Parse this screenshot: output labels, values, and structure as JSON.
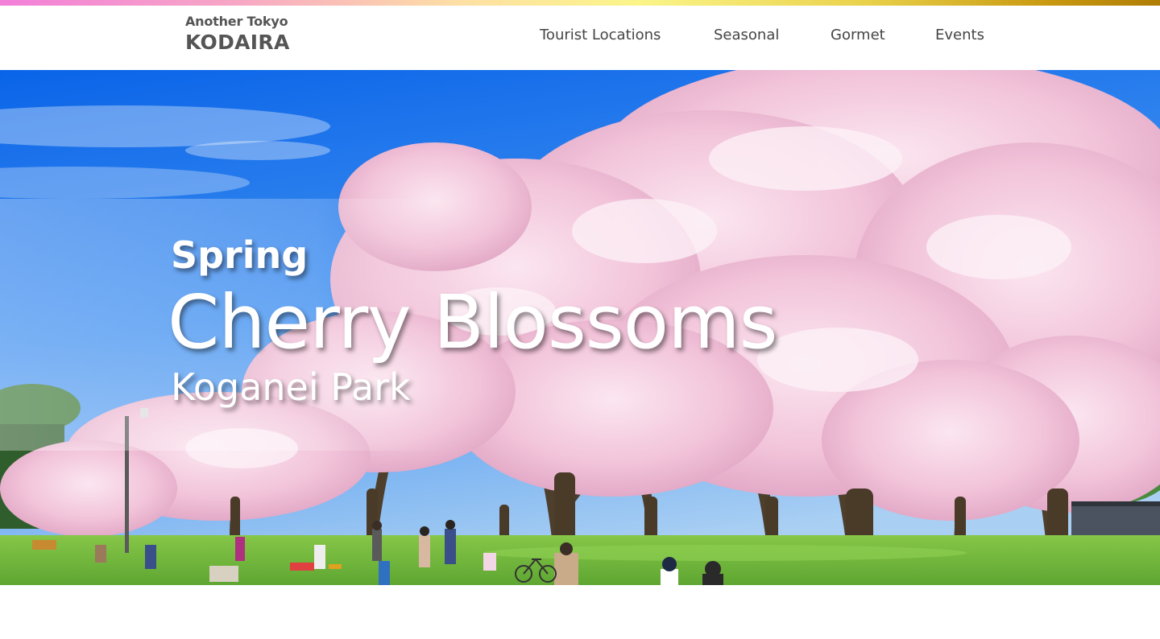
{
  "site": {
    "logo_small": "Another Tokyo",
    "logo_big": "KODAIRA"
  },
  "nav": {
    "items": [
      {
        "label": "Tourist Locations"
      },
      {
        "label": "Seasonal"
      },
      {
        "label": "Gormet"
      },
      {
        "label": "Events"
      }
    ]
  },
  "hero": {
    "season": "Spring",
    "title": "Cherry Blossoms",
    "place": "Koganei Park"
  },
  "colors": {
    "sky_top": "#0a6ef0",
    "sky_bottom": "#8fc2f2",
    "blossom": "#f3c6dc",
    "grass": "#6fb63c",
    "text_header": "#555555"
  }
}
